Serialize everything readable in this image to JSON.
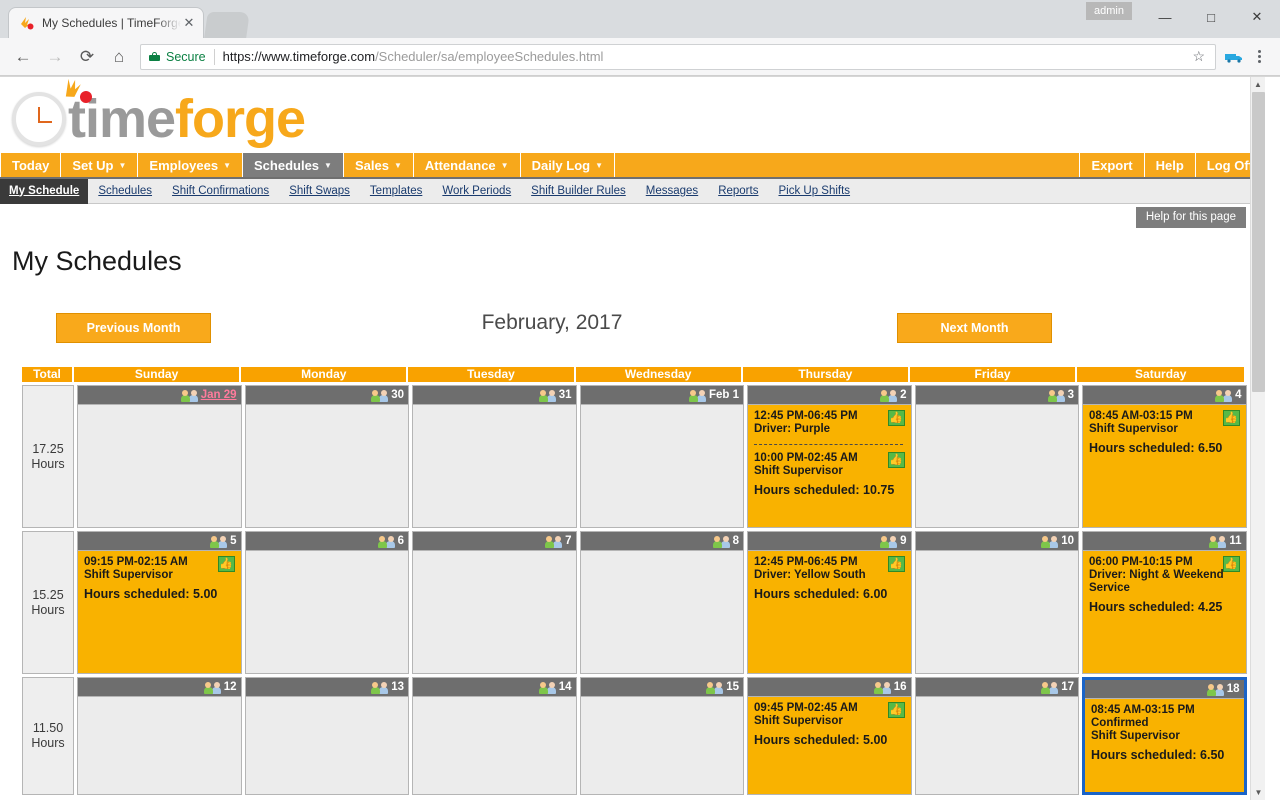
{
  "browser": {
    "tab_title": "My Schedules | TimeForge",
    "tab_close": "✕",
    "back": "←",
    "forward": "→",
    "reload": "⟳",
    "home": "⌂",
    "secure_label": "Secure",
    "url_protocol": "https://www.timeforge.com",
    "url_path": "/Scheduler/sa/employeeSchedules.html",
    "star_icon": "☆",
    "user_badge": "admin",
    "minimize": "—",
    "maximize": "□",
    "close": "✕"
  },
  "logo": {
    "part1": "time",
    "part2": "forge"
  },
  "mainnav": {
    "items": [
      {
        "label": "Today",
        "caret": false,
        "active": false
      },
      {
        "label": "Set Up",
        "caret": true,
        "active": false
      },
      {
        "label": "Employees",
        "caret": true,
        "active": false
      },
      {
        "label": "Schedules",
        "caret": true,
        "active": true
      },
      {
        "label": "Sales",
        "caret": true,
        "active": false
      },
      {
        "label": "Attendance",
        "caret": true,
        "active": false
      },
      {
        "label": "Daily Log",
        "caret": true,
        "active": false
      }
    ],
    "right_items": [
      {
        "label": "Export"
      },
      {
        "label": "Help"
      },
      {
        "label": "Log Off"
      }
    ]
  },
  "subnav": {
    "items": [
      {
        "label": "My Schedule",
        "active": true
      },
      {
        "label": "Schedules",
        "active": false
      },
      {
        "label": "Shift Confirmations",
        "active": false
      },
      {
        "label": "Shift Swaps",
        "active": false
      },
      {
        "label": "Templates",
        "active": false
      },
      {
        "label": "Work Periods",
        "active": false
      },
      {
        "label": "Shift Builder Rules",
        "active": false
      },
      {
        "label": "Messages",
        "active": false
      },
      {
        "label": "Reports",
        "active": false
      },
      {
        "label": "Pick Up Shifts",
        "active": false
      }
    ]
  },
  "help_tab": "Help for this page",
  "page_title": "My Schedules",
  "month_nav": {
    "previous": "Previous Month",
    "next": "Next Month",
    "current": "February, 2017"
  },
  "calendar": {
    "total_header": "Total",
    "day_headers": [
      "Sunday",
      "Monday",
      "Tuesday",
      "Wednesday",
      "Thursday",
      "Friday",
      "Saturday"
    ],
    "weeks": [
      {
        "total": "17.25",
        "total_unit": "Hours",
        "days": [
          {
            "num": "Jan 29",
            "link": true,
            "filled": false,
            "shifts": [],
            "hours": ""
          },
          {
            "num": "30",
            "link": false,
            "filled": false,
            "shifts": [],
            "hours": ""
          },
          {
            "num": "31",
            "link": false,
            "filled": false,
            "shifts": [],
            "hours": ""
          },
          {
            "num": "Feb 1",
            "link": false,
            "filled": false,
            "shifts": [],
            "hours": ""
          },
          {
            "num": "2",
            "link": false,
            "filled": true,
            "shifts": [
              {
                "time": "12:45 PM-06:45 PM",
                "role": "Driver: Purple",
                "thumb": true,
                "confirmed": ""
              },
              {
                "time": "10:00 PM-02:45 AM",
                "role": "Shift Supervisor",
                "thumb": true,
                "confirmed": ""
              }
            ],
            "hours": "Hours scheduled: 10.75"
          },
          {
            "num": "3",
            "link": false,
            "filled": false,
            "shifts": [],
            "hours": ""
          },
          {
            "num": "4",
            "link": false,
            "filled": true,
            "shifts": [
              {
                "time": "08:45 AM-03:15 PM",
                "role": "Shift Supervisor",
                "thumb": true,
                "confirmed": ""
              }
            ],
            "hours": "Hours scheduled: 6.50"
          }
        ]
      },
      {
        "total": "15.25",
        "total_unit": "Hours",
        "days": [
          {
            "num": "5",
            "link": false,
            "filled": true,
            "shifts": [
              {
                "time": "09:15 PM-02:15 AM",
                "role": "Shift Supervisor",
                "thumb": true,
                "confirmed": ""
              }
            ],
            "hours": "Hours scheduled: 5.00"
          },
          {
            "num": "6",
            "link": false,
            "filled": false,
            "shifts": [],
            "hours": ""
          },
          {
            "num": "7",
            "link": false,
            "filled": false,
            "shifts": [],
            "hours": ""
          },
          {
            "num": "8",
            "link": false,
            "filled": false,
            "shifts": [],
            "hours": ""
          },
          {
            "num": "9",
            "link": false,
            "filled": true,
            "shifts": [
              {
                "time": "12:45 PM-06:45 PM",
                "role": "Driver: Yellow South",
                "thumb": true,
                "confirmed": ""
              }
            ],
            "hours": "Hours scheduled: 6.00"
          },
          {
            "num": "10",
            "link": false,
            "filled": false,
            "shifts": [],
            "hours": ""
          },
          {
            "num": "11",
            "link": false,
            "filled": true,
            "shifts": [
              {
                "time": "06:00 PM-10:15 PM",
                "role": "Driver: Night & Weekend Service",
                "thumb": true,
                "confirmed": ""
              }
            ],
            "hours": "Hours scheduled: 4.25"
          }
        ]
      },
      {
        "total": "11.50",
        "total_unit": "Hours",
        "days": [
          {
            "num": "12",
            "link": false,
            "filled": false,
            "shifts": [],
            "hours": ""
          },
          {
            "num": "13",
            "link": false,
            "filled": false,
            "shifts": [],
            "hours": ""
          },
          {
            "num": "14",
            "link": false,
            "filled": false,
            "shifts": [],
            "hours": ""
          },
          {
            "num": "15",
            "link": false,
            "filled": false,
            "shifts": [],
            "hours": ""
          },
          {
            "num": "16",
            "link": false,
            "filled": true,
            "shifts": [
              {
                "time": "09:45 PM-02:45 AM",
                "role": "Shift Supervisor",
                "thumb": true,
                "confirmed": ""
              }
            ],
            "hours": "Hours scheduled: 5.00"
          },
          {
            "num": "17",
            "link": false,
            "filled": false,
            "shifts": [],
            "hours": ""
          },
          {
            "num": "18",
            "link": false,
            "filled": true,
            "selected": true,
            "shifts": [
              {
                "time": "08:45 AM-03:15 PM",
                "role": "Shift Supervisor",
                "thumb": false,
                "confirmed": "Confirmed"
              }
            ],
            "hours": "Hours scheduled: 6.50"
          }
        ]
      }
    ]
  },
  "colors": {
    "brand_orange": "#f9a200",
    "nav_orange": "#f7a81b",
    "shift_yellow": "#f9b200",
    "dayhead_gray": "#6e6e6e",
    "selected_blue": "#1a64c8",
    "thumb_green": "#57b947"
  }
}
